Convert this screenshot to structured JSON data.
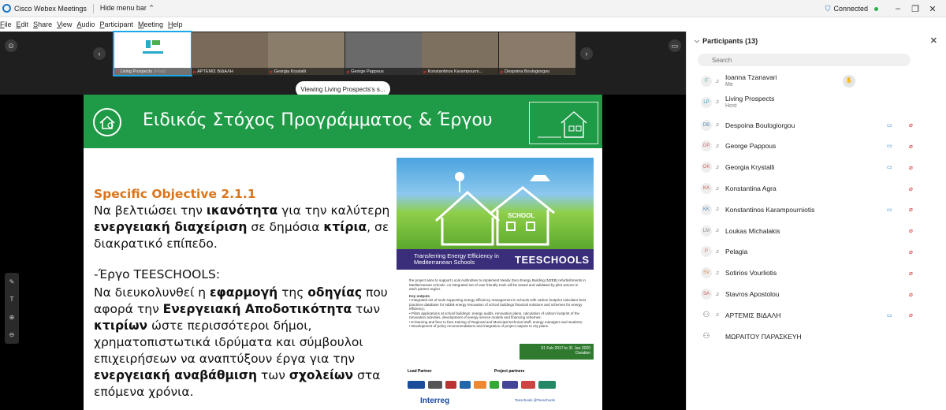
{
  "titlebar": {
    "title": "Cisco Webex Meetings",
    "hide_menu": "Hide menu bar ⌃",
    "connected": "Connected",
    "conn_icon": "shield-icon"
  },
  "menu": [
    {
      "pre": "",
      "u": "F",
      "post": "ile"
    },
    {
      "pre": "",
      "u": "E",
      "post": "dit"
    },
    {
      "pre": "",
      "u": "S",
      "post": "hare"
    },
    {
      "pre": "",
      "u": "V",
      "post": "iew"
    },
    {
      "pre": "",
      "u": "A",
      "post": "udio"
    },
    {
      "pre": "",
      "u": "P",
      "post": "articipant"
    },
    {
      "pre": "",
      "u": "M",
      "post": "eeting"
    },
    {
      "pre": "",
      "u": "H",
      "post": "elp"
    }
  ],
  "filmstrip": {
    "tiles": [
      {
        "label": "Living Prospects",
        "role": "(Host)"
      },
      {
        "label": "ΑΡΤΕΜΙΣ ΒΙΔΑΛΗ",
        "role": ""
      },
      {
        "label": "Georgia Krystalli",
        "role": ""
      },
      {
        "label": "George Pappous",
        "role": ""
      },
      {
        "label": "Konstantinos Karampourni...",
        "role": ""
      },
      {
        "label": "Despoina Boulogiorgou",
        "role": ""
      }
    ],
    "viewing": "Viewing Living Prospects's s..."
  },
  "slide": {
    "title": "Ειδικός Στόχος Προγράμματος & Έργου",
    "objective": "Specific Objective 2.1.1",
    "p1": [
      "Να βελτιώσει την ",
      "ικανότητα",
      " για την καλύτερη ",
      "ενεργειακή διαχείριση",
      " σε δημόσια ",
      "κτίρια",
      ", σε διακρατικό επίπεδο."
    ],
    "project": "-Έργο TEESCHOOLS:",
    "p2": [
      "Να διευκολυνθεί η ",
      "εφαρμογή",
      " της ",
      "οδηγίας",
      " που αφορά την ",
      "Ενεργειακή Αποδοτικότητα",
      " των ",
      "κτιρίων",
      " ώστε περισσότεροι δήμοι, χρηματοπιστωτικά ιδρύματα και σύμβουλοι επιχειρήσεων να αναπτύξουν έργα για την ",
      "ενεργειακή αναβάθμιση",
      " των ",
      "σχολείων",
      " στα επόμενα χρόνια."
    ]
  },
  "poster": {
    "school": "SCHOOL",
    "band_left": "Transferring Energy Efficiency in Mediterranean Schools",
    "band_right": "TEESCHOOLS",
    "intro": "the project aims to support Local Authorities to implement Nearly Zero Energy Building (NZEB) refurbishments in Mediterranean schools. An integrated set of user friendly tools will be tested and validated by pilot actions in each partner region.",
    "key_head": "Key outputs",
    "outputs": [
      "• Integrated set of tools supporting energy efficiency management in schools with carbon footprint calculator best practices database for NZEB energy renovation of school buildings financial solutions and schemes for energy efficiency;",
      "• Pilots applications at school buildings: energy audits, renovation plans, calculation of carbon footprint of the renovation activities, development of energy service models and financing schemes;",
      "• E-learning and face to face training of Regional and Municipal technical staff, energy managers and students;",
      "• Development of policy recommendations and integration of project outputs to city plans."
    ],
    "dates": "01 Feb 2017 to 31 Jan 2020",
    "duration": "Duration",
    "lead": "Lead Partner",
    "partners": "Project partners",
    "interreg": "Interreg",
    "social": "Teeschools  @Teeschools"
  },
  "panel": {
    "title": "Participants (13)",
    "search_placeholder": "Search",
    "participants": [
      {
        "initials": "IT",
        "name": "Ioanna Tzanavari",
        "sub": "Me",
        "cam": false,
        "mute": false,
        "raise": true
      },
      {
        "initials": "LP",
        "name": "Living Prospects",
        "sub": "Host",
        "cam": false,
        "mute": false,
        "raise": false
      },
      {
        "initials": "DB",
        "name": "Despoina Boulogiorgou",
        "sub": "",
        "cam": true,
        "mute": true,
        "raise": false
      },
      {
        "initials": "GP",
        "name": "George Pappous",
        "sub": "",
        "cam": true,
        "mute": true,
        "raise": false
      },
      {
        "initials": "GK",
        "name": "Georgia Krystalli",
        "sub": "",
        "cam": true,
        "mute": true,
        "raise": false
      },
      {
        "initials": "KA",
        "name": "Konstantina Agra",
        "sub": "",
        "cam": false,
        "mute": true,
        "raise": false
      },
      {
        "initials": "KK",
        "name": "Konstantinos Karampourniotis",
        "sub": "",
        "cam": true,
        "mute": true,
        "raise": false
      },
      {
        "initials": "LM",
        "name": "Loukas Michalakis",
        "sub": "",
        "cam": false,
        "mute": true,
        "raise": false
      },
      {
        "initials": "P",
        "name": "Pelagia",
        "sub": "",
        "cam": false,
        "mute": true,
        "raise": false
      },
      {
        "initials": "SV",
        "name": "Sotirios Vourliotis",
        "sub": "",
        "cam": false,
        "mute": true,
        "raise": false
      },
      {
        "initials": "SA",
        "name": "Stavros Apostolou",
        "sub": "",
        "cam": false,
        "mute": true,
        "raise": false
      },
      {
        "initials": "",
        "name": "ΑΡΤΕΜΙΣ ΒΙΔΑΛΗ",
        "sub": "",
        "cam": true,
        "mute": true,
        "raise": false
      },
      {
        "initials": "",
        "name": "ΜΩΡΑΙΤΟΥ ΠΑΡΑΣΚΕΥΗ",
        "sub": "",
        "cam": false,
        "mute": false,
        "raise": false
      }
    ]
  },
  "colors": {
    "banner_green": "#1f9a47",
    "objective_orange": "#d9761d",
    "poster_band": "#3a2d7a",
    "active_tile": "#17a9e8",
    "mute_red": "#e03030"
  }
}
